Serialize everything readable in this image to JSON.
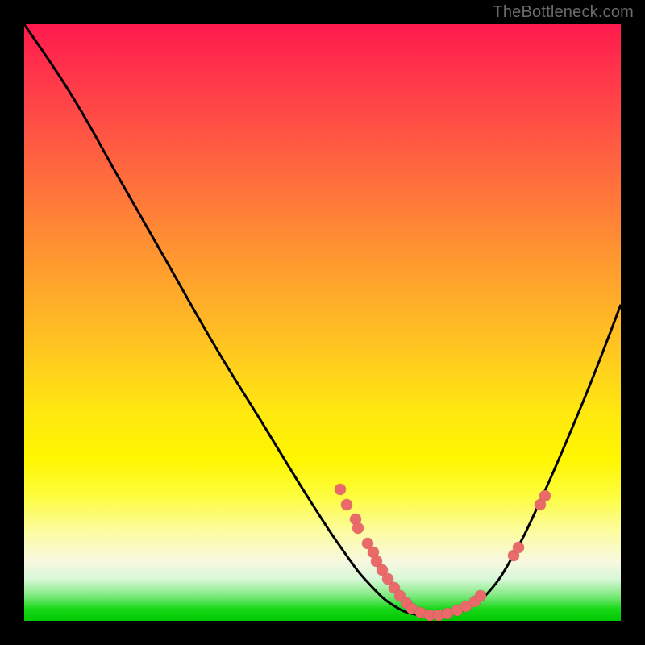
{
  "watermark": "TheBottleneck.com",
  "colors": {
    "curve_stroke": "#000000",
    "marker_fill": "#ea6a6a",
    "bg": "#000000"
  },
  "chart_data": {
    "type": "line",
    "title": "",
    "xlabel": "",
    "ylabel": "",
    "xlim": [
      0,
      100
    ],
    "ylim": [
      0,
      100
    ],
    "note": "No axis ticks or numeric labels are visible in the image; x/y are treated as 0–100% of the plotting area. y=0 is the bottom (green) edge; higher y = warmer colors.",
    "curve_points": [
      {
        "x": 0,
        "y": 100
      },
      {
        "x": 8,
        "y": 88
      },
      {
        "x": 16,
        "y": 74
      },
      {
        "x": 24,
        "y": 60
      },
      {
        "x": 32,
        "y": 46
      },
      {
        "x": 40,
        "y": 33
      },
      {
        "x": 48,
        "y": 20
      },
      {
        "x": 54,
        "y": 11
      },
      {
        "x": 58,
        "y": 6
      },
      {
        "x": 62,
        "y": 2.5
      },
      {
        "x": 66,
        "y": 1
      },
      {
        "x": 70,
        "y": 1
      },
      {
        "x": 74,
        "y": 2
      },
      {
        "x": 78,
        "y": 5
      },
      {
        "x": 82,
        "y": 11
      },
      {
        "x": 86,
        "y": 19
      },
      {
        "x": 90,
        "y": 28
      },
      {
        "x": 95,
        "y": 40
      },
      {
        "x": 100,
        "y": 53
      }
    ],
    "markers": [
      {
        "x": 53,
        "y": 22
      },
      {
        "x": 54,
        "y": 19.5
      },
      {
        "x": 55.5,
        "y": 17
      },
      {
        "x": 56,
        "y": 15.5
      },
      {
        "x": 57.5,
        "y": 13
      },
      {
        "x": 58.5,
        "y": 11.5
      },
      {
        "x": 59,
        "y": 10
      },
      {
        "x": 60,
        "y": 8.5
      },
      {
        "x": 61,
        "y": 7
      },
      {
        "x": 62,
        "y": 5.5
      },
      {
        "x": 63,
        "y": 4.2
      },
      {
        "x": 64,
        "y": 3
      },
      {
        "x": 65,
        "y": 2
      },
      {
        "x": 66.5,
        "y": 1.3
      },
      {
        "x": 68,
        "y": 1
      },
      {
        "x": 69.5,
        "y": 1
      },
      {
        "x": 71,
        "y": 1.2
      },
      {
        "x": 72.5,
        "y": 1.7
      },
      {
        "x": 74,
        "y": 2.4
      },
      {
        "x": 75.5,
        "y": 3.3
      },
      {
        "x": 76.5,
        "y": 4.2
      },
      {
        "x": 82,
        "y": 11
      },
      {
        "x": 82.8,
        "y": 12.3
      },
      {
        "x": 86.5,
        "y": 19.5
      },
      {
        "x": 87.3,
        "y": 21
      }
    ]
  }
}
